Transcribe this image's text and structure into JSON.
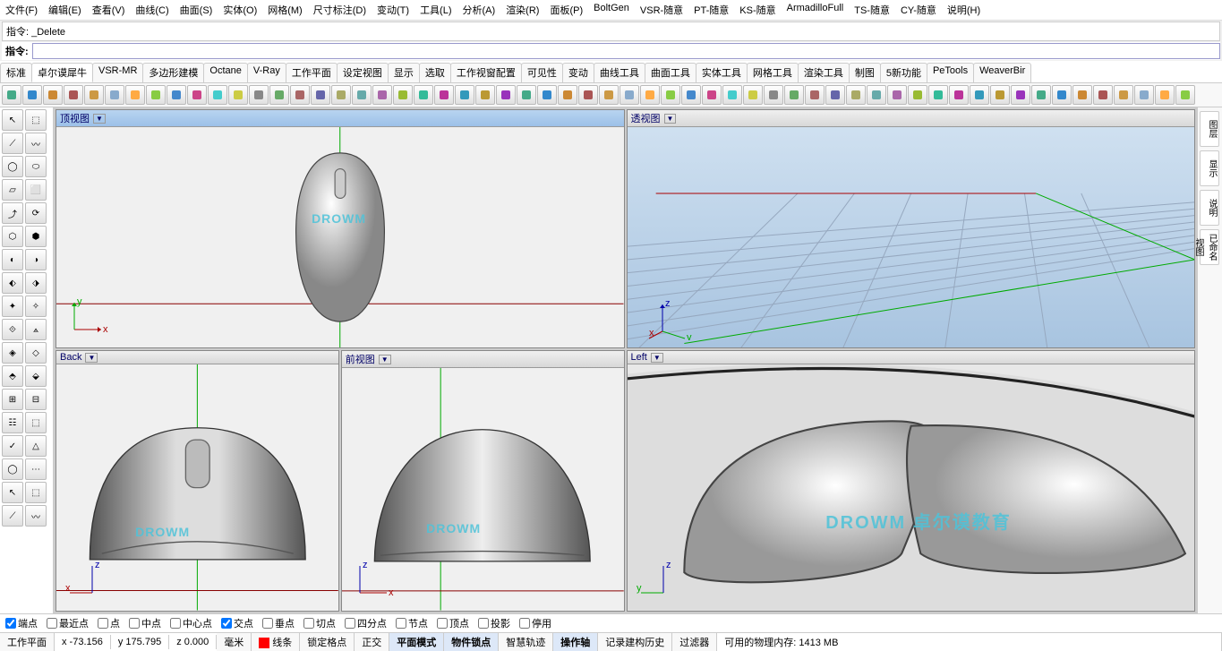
{
  "menu": [
    "文件(F)",
    "编辑(E)",
    "查看(V)",
    "曲线(C)",
    "曲面(S)",
    "实体(O)",
    "网格(M)",
    "尺寸标注(D)",
    "变动(T)",
    "工具(L)",
    "分析(A)",
    "渲染(R)",
    "面板(P)",
    "BoltGen",
    "VSR-随意",
    "PT-随意",
    "KS-随意",
    "ArmadilloFull",
    "TS-随意",
    "CY-随意",
    "说明(H)"
  ],
  "cmd_history": "指令: _Delete",
  "cmd_label": "指令:",
  "tabs": [
    "标准",
    "卓尔谟犀牛",
    "VSR-MR",
    "多边形建模",
    "Octane",
    "V-Ray",
    "工作平面",
    "设定视图",
    "显示",
    "选取",
    "工作视窗配置",
    "可见性",
    "变动",
    "曲线工具",
    "曲面工具",
    "实体工具",
    "网格工具",
    "渲染工具",
    "制图",
    "5新功能",
    "PeTools",
    "WeaverBir"
  ],
  "active_tab": 1,
  "viewports": {
    "top": {
      "name": "顶视图"
    },
    "persp": {
      "name": "透视图"
    },
    "back": {
      "name": "Back"
    },
    "front": {
      "name": "前视图"
    },
    "left": {
      "name": "Left"
    }
  },
  "watermark_small": "DROWM",
  "watermark_large": "DROWM 卓尔谟教育",
  "osnap": {
    "items": [
      {
        "label": "端点",
        "checked": true
      },
      {
        "label": "最近点",
        "checked": false
      },
      {
        "label": "点",
        "checked": false
      },
      {
        "label": "中点",
        "checked": false
      },
      {
        "label": "中心点",
        "checked": false
      },
      {
        "label": "交点",
        "checked": true
      },
      {
        "label": "垂点",
        "checked": false
      },
      {
        "label": "切点",
        "checked": false
      },
      {
        "label": "四分点",
        "checked": false
      },
      {
        "label": "节点",
        "checked": false
      },
      {
        "label": "顶点",
        "checked": false
      },
      {
        "label": "投影",
        "checked": false
      },
      {
        "label": "停用",
        "checked": false
      }
    ]
  },
  "status": {
    "cplane": "工作平面",
    "x": "x -73.156",
    "y": "y 175.795",
    "z": "z 0.000",
    "units": "毫米",
    "layer_swatch": "#ff0000",
    "layer_name": "线条",
    "grid_snap": "锁定格点",
    "ortho": "正交",
    "planar": "平面模式",
    "osnap_toggle": "物件锁点",
    "smarttrack": "智慧轨迹",
    "gumball": "操作轴",
    "history": "记录建构历史",
    "filter": "过滤器",
    "memory": "可用的物理内存: 1413 MB"
  },
  "right_tabs": [
    "图层",
    "显示",
    "说明",
    "已命名视图"
  ]
}
